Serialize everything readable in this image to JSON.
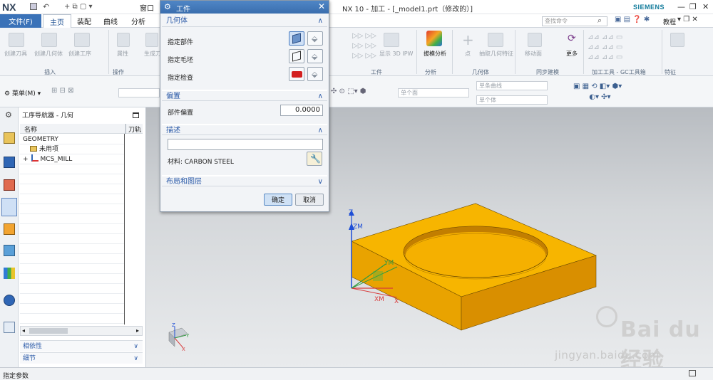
{
  "app": {
    "logo": "NX",
    "window_title": "NX 10 - 加工 - [_model1.prt（修改的）]",
    "brand": "SIEMENS",
    "window_controls": [
      "minimize-icon",
      "restore-icon",
      "close-icon"
    ]
  },
  "menubar": {
    "file": "文件(F)",
    "tabs": [
      "主页",
      "装配",
      "曲线",
      "分析"
    ],
    "window_menu": "窗口",
    "search_placeholder": "查找命令",
    "tutorial": "教程"
  },
  "ribbon": {
    "home_buttons": [
      "创建刀具",
      "创建几何体",
      "创建工序",
      "属性",
      "生成刀"
    ],
    "group_insert": "插入",
    "group_operation": "操作",
    "right_buttons": [
      "显示 3D IPW",
      "拔模分析",
      "点",
      "抽取几何特征",
      "移动面",
      "更多"
    ],
    "groups_right": [
      "工件",
      "分析",
      "几何体",
      "同步建模",
      "加工工具 - GC工具箱",
      "特征"
    ]
  },
  "toolbar2": {
    "menu": "菜单(M)",
    "filter_face": "单个面",
    "filter_curve": "单条曲线",
    "filter_body": "单个体"
  },
  "navigator": {
    "title": "工序导航器 - 几何",
    "columns": [
      "名称",
      "刀轨"
    ],
    "rows": [
      {
        "label": "GEOMETRY",
        "indent": 0
      },
      {
        "label": "未用项",
        "indent": 1
      },
      {
        "label": "MCS_MILL",
        "indent": 1
      }
    ],
    "sections": [
      "相依性",
      "细节"
    ]
  },
  "dialog": {
    "title": "工件",
    "sections": {
      "geometry": "几何体",
      "offset": "偏置",
      "description": "描述",
      "layout": "布局和图层"
    },
    "specify_part": "指定部件",
    "specify_blank": "指定毛坯",
    "specify_check": "指定检查",
    "part_offset_label": "部件偏置",
    "part_offset_value": "0.0000",
    "material_label": "材料: CARBON STEEL",
    "ok": "确定",
    "cancel": "取消"
  },
  "viewport": {
    "axis_z": "Z",
    "axis_zm": "ZM",
    "axis_ym": "YM",
    "axis_xm": "XM",
    "axis_x": "X",
    "triad_z": "Z",
    "triad_y": "Y",
    "triad_x": "X"
  },
  "status": {
    "text": "指定参数"
  },
  "watermark": {
    "text": "jingyan.baidu.com"
  },
  "colors": {
    "part_fill": "#f7b500",
    "part_side": "#d98f00",
    "accent": "#3a72b8",
    "brand": "#0f7a9a"
  }
}
